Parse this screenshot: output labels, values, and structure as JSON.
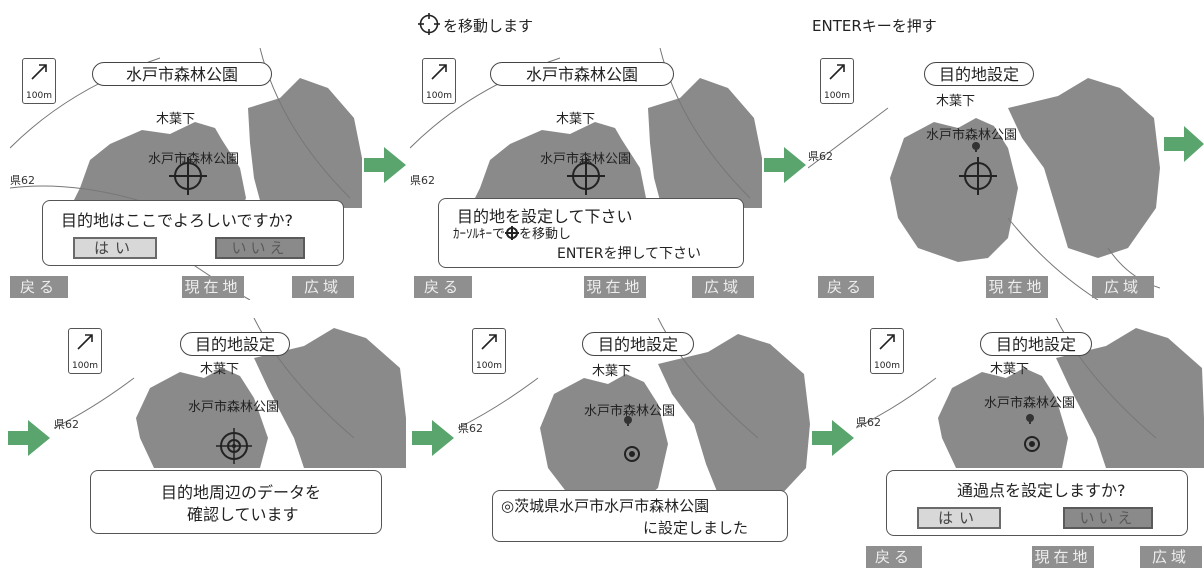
{
  "captions": {
    "move_cursor": "を移動します",
    "press_enter": "ENTERキーを押す"
  },
  "map": {
    "scale": "100m",
    "road": "県62",
    "place_kibashita": "木葉下",
    "place_park": "水戸市森林公園"
  },
  "screens": [
    {
      "title": "水戸市森林公園",
      "dialog_lines": [
        "目的地はここでよろしいですか?"
      ],
      "yes": "はい",
      "no": "いいえ",
      "softkeys": [
        "戻る",
        "現在地",
        "広域"
      ]
    },
    {
      "title": "水戸市森林公園",
      "dialog_lines": [
        "目的地を設定して下さい",
        "ｶｰｿﾙｷｰで",
        "を移動し",
        "ENTERを押して下さい"
      ],
      "softkeys": [
        "戻る",
        "現在地",
        "広域"
      ]
    },
    {
      "title": "目的地設定",
      "softkeys": [
        "戻る",
        "現在地",
        "広域"
      ]
    },
    {
      "title": "目的地設定",
      "dialog_lines": [
        "目的地周辺のデータを",
        "確認しています"
      ]
    },
    {
      "title": "目的地設定",
      "dialog_lines": [
        "◎茨城県水戸市水戸市森林公園",
        "に設定しました"
      ]
    },
    {
      "title": "目的地設定",
      "dialog_lines": [
        "通過点を設定しますか?"
      ],
      "yes": "はい",
      "no": "いいえ",
      "softkeys": [
        "戻る",
        "現在地",
        "広域"
      ]
    }
  ]
}
